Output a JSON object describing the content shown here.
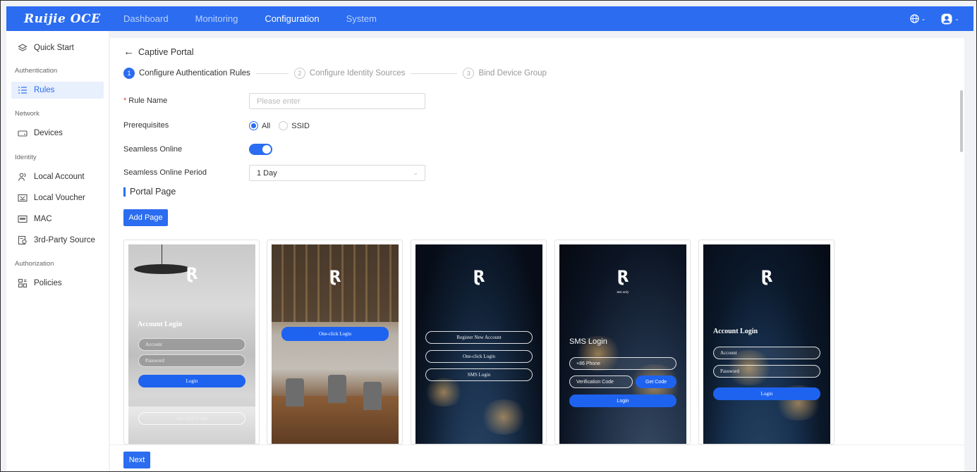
{
  "app": {
    "logo": "Ruijie OCE"
  },
  "nav": {
    "items": [
      {
        "label": "Dashboard",
        "active": false
      },
      {
        "label": "Monitoring",
        "active": false
      },
      {
        "label": "Configuration",
        "active": true
      },
      {
        "label": "System",
        "active": false
      }
    ]
  },
  "topbar_icons": [
    "globe-icon",
    "user-avatar-icon"
  ],
  "sidebar": {
    "quick_start": "Quick Start",
    "groups": {
      "authentication": "Authentication",
      "network": "Network",
      "identity": "Identity",
      "authorization": "Authorization"
    },
    "items": {
      "rules": "Rules",
      "devices": "Devices",
      "local_account": "Local Account",
      "local_voucher": "Local Voucher",
      "mac": "MAC",
      "third_party": "3rd-Party Source",
      "policies": "Policies"
    },
    "active_item": "Rules"
  },
  "page": {
    "back_title": "Captive Portal",
    "steps": [
      {
        "num": "1",
        "label": "Configure Authentication Rules",
        "active": true
      },
      {
        "num": "2",
        "label": "Configure Identity Sources",
        "active": false
      },
      {
        "num": "3",
        "label": "Bind Device Group",
        "active": false
      }
    ]
  },
  "form": {
    "rule_name_label": "Rule Name",
    "rule_name_placeholder": "Please enter",
    "prerequisites_label": "Prerequisites",
    "prereq_options": [
      "All",
      "SSID"
    ],
    "prereq_selected": "All",
    "seamless_label": "Seamless Online",
    "seamless_enabled": true,
    "period_label": "Seamless Online Period",
    "period_value": "1 Day"
  },
  "portal": {
    "section_title": "Portal Page",
    "add_button": "Add Page",
    "cards": {
      "c1": {
        "title": "Account Login",
        "account": "Account",
        "password": "Password",
        "login": "Login",
        "one_click": "One-click Login"
      },
      "c2": {
        "one_click": "One-click Login"
      },
      "c3": {
        "register": "Register New Account",
        "one_click": "One-click Login",
        "sms": "SMS Login"
      },
      "c4": {
        "tagline": "test only",
        "title": "SMS Login",
        "phone": "+86  Phone",
        "code": "Verification Code",
        "get_code": "Get Code",
        "login": "Login"
      },
      "c5": {
        "title": "Account Login",
        "account": "Account",
        "password": "Password",
        "login": "Login"
      }
    }
  },
  "footer": {
    "next_button": "Next"
  },
  "colors": {
    "primary": "#2b6cf0",
    "active_bg": "#e8f0fe"
  }
}
